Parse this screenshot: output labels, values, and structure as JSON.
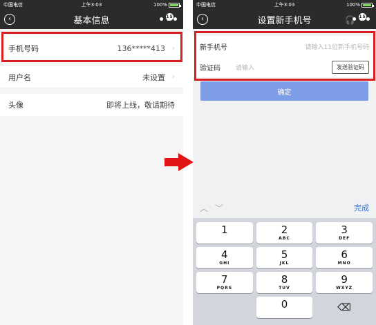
{
  "status": {
    "carrier": "中国电信",
    "time": "上午3:03",
    "battery": "100%"
  },
  "left": {
    "title": "基本信息",
    "badge": "15",
    "rows": [
      {
        "label": "手机号码",
        "value": "136*****413"
      },
      {
        "label": "用户名",
        "value": "未设置"
      },
      {
        "label": "头像",
        "value": "即将上线，敬请期待"
      }
    ]
  },
  "right": {
    "title": "设置新手机号",
    "badge": "15",
    "new_phone_label": "新手机号",
    "new_phone_placeholder": "请输入11位新手机号码",
    "code_label": "验证码",
    "code_placeholder": "请输入",
    "send_code_label": "发送验证码",
    "confirm_label": "确定"
  },
  "keyboard": {
    "done_label": "完成",
    "keys": [
      {
        "num": "1",
        "letters": ""
      },
      {
        "num": "2",
        "letters": "ABC"
      },
      {
        "num": "3",
        "letters": "DEF"
      },
      {
        "num": "4",
        "letters": "GHI"
      },
      {
        "num": "5",
        "letters": "JKL"
      },
      {
        "num": "6",
        "letters": "MNO"
      },
      {
        "num": "7",
        "letters": "PQRS"
      },
      {
        "num": "8",
        "letters": "TUV"
      },
      {
        "num": "9",
        "letters": "WXYZ"
      },
      {
        "num": "0",
        "letters": ""
      }
    ]
  },
  "colors": {
    "highlight": "#d81e1e",
    "arrow": "#e01515",
    "confirm_button": "#7d9ee7",
    "done": "#2d78d8"
  }
}
